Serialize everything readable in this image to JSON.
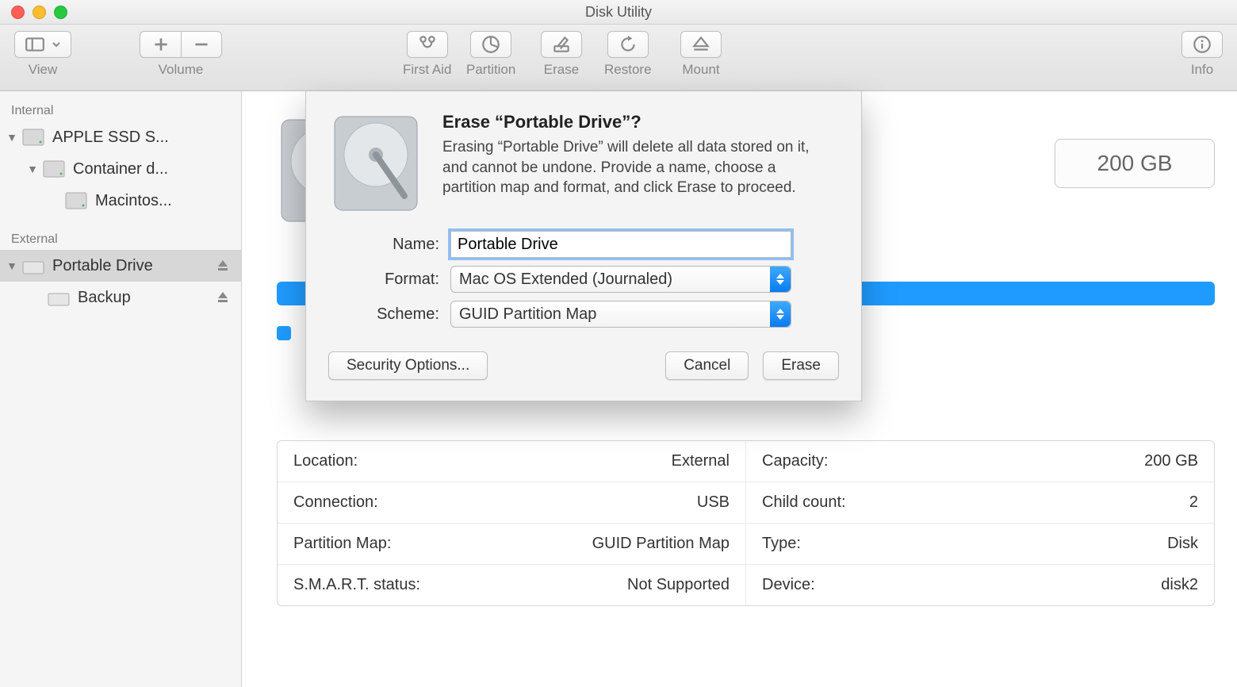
{
  "window": {
    "title": "Disk Utility"
  },
  "toolbar": {
    "view": "View",
    "volume": "Volume",
    "first_aid": "First Aid",
    "partition": "Partition",
    "erase": "Erase",
    "restore": "Restore",
    "mount": "Mount",
    "info": "Info"
  },
  "sidebar": {
    "internal_heading": "Internal",
    "external_heading": "External",
    "internal": [
      {
        "label": "APPLE SSD S...",
        "indent": 0,
        "ejectable": false
      },
      {
        "label": "Container d...",
        "indent": 1,
        "ejectable": false
      },
      {
        "label": "Macintos...",
        "indent": 2,
        "ejectable": false
      }
    ],
    "external": [
      {
        "label": "Portable Drive",
        "indent": 0,
        "ejectable": true,
        "selected": true
      },
      {
        "label": "Backup",
        "indent": 1,
        "ejectable": true
      }
    ]
  },
  "capacity_badge": "200 GB",
  "info": {
    "left": [
      {
        "label": "Location:",
        "value": "External"
      },
      {
        "label": "Connection:",
        "value": "USB"
      },
      {
        "label": "Partition Map:",
        "value": "GUID Partition Map"
      },
      {
        "label": "S.M.A.R.T. status:",
        "value": "Not Supported"
      }
    ],
    "right": [
      {
        "label": "Capacity:",
        "value": "200 GB"
      },
      {
        "label": "Child count:",
        "value": "2"
      },
      {
        "label": "Type:",
        "value": "Disk"
      },
      {
        "label": "Device:",
        "value": "disk2"
      }
    ]
  },
  "dialog": {
    "heading": "Erase “Portable Drive”?",
    "message": "Erasing “Portable Drive” will delete all data stored on it, and cannot be undone. Provide a name, choose a partition map and format, and click Erase to proceed.",
    "name_label": "Name:",
    "name_value": "Portable Drive",
    "format_label": "Format:",
    "format_value": "Mac OS Extended (Journaled)",
    "scheme_label": "Scheme:",
    "scheme_value": "GUID Partition Map",
    "security_options": "Security Options...",
    "cancel": "Cancel",
    "erase": "Erase"
  }
}
